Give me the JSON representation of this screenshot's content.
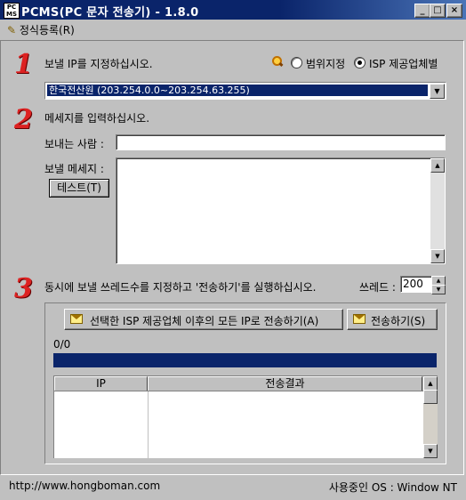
{
  "window": {
    "title": "PCMS(PC 문자 전송기) - 1.8.0",
    "app_icon_text": "PC MS",
    "minimize": "_",
    "maximize": "□",
    "close": "×"
  },
  "menu": {
    "register_label": "정식등록(R)"
  },
  "step1": {
    "number": "1",
    "instruction": "보낼 IP를 지정하십시오.",
    "radio_range_label": "범위지정",
    "radio_isp_label": "ISP 제공업체별",
    "selected_radio": "isp",
    "select_value": "한국전산원 (203.254.0.0~203.254.63.255)"
  },
  "step2": {
    "number": "2",
    "instruction": "메세지를 입력하십시오.",
    "sender_label": "보내는 사람 :",
    "sender_value": "",
    "message_label": "보낼 메세지 :",
    "message_value": "",
    "test_button": "테스트(T)"
  },
  "step3": {
    "number": "3",
    "instruction": "동시에 보낼 쓰레드수를 지정하고 '전송하기'를 실행하십시오.",
    "thread_label": "쓰레드 :",
    "thread_value": "200",
    "send_isp_button": "선택한 ISP 제공업체 이후의 모든 IP로 전송하기(A)",
    "send_button": "전송하기(S)",
    "progress_text": "0/0",
    "progress_fraction": 1.0,
    "columns": [
      "IP",
      "전송결과"
    ]
  },
  "status": {
    "url": "http://www.hongboman.com",
    "os": "사용중인 OS : Window NT"
  },
  "colors": {
    "titlebar": "#0a246a",
    "progress": "#0a246a",
    "step_number": "#dd2222"
  }
}
